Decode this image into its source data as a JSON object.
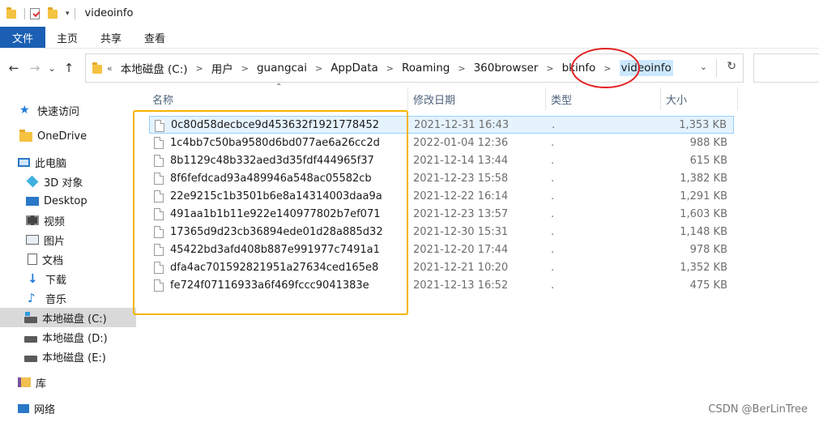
{
  "window": {
    "title": "videoinfo"
  },
  "quick_access_toolbar": {
    "icons": [
      "folder-icon",
      "properties-icon",
      "new-folder-icon",
      "dropdown-icon"
    ]
  },
  "ribbon": {
    "tabs": [
      "文件",
      "主页",
      "共享",
      "查看"
    ]
  },
  "address": {
    "crumbs": [
      "本地磁盘 (C:)",
      "用户",
      "guangcai",
      "AppData",
      "Roaming",
      "360browser",
      "bkinfo",
      "videoinfo"
    ],
    "overflow": "«"
  },
  "nav": {
    "back": "←",
    "forward": "→",
    "recent": "⌄",
    "up": "↑",
    "refresh": "↻"
  },
  "sidebar": {
    "items": [
      {
        "label": "快速访问",
        "icon": "star-icon"
      },
      {
        "label": "OneDrive",
        "icon": "folder-icon"
      },
      {
        "label": "此电脑",
        "icon": "pc-icon"
      },
      {
        "label": "3D 对象",
        "icon": "cube-icon"
      },
      {
        "label": "Desktop",
        "icon": "desktop-icon"
      },
      {
        "label": "视频",
        "icon": "video-icon"
      },
      {
        "label": "图片",
        "icon": "picture-icon"
      },
      {
        "label": "文档",
        "icon": "document-icon"
      },
      {
        "label": "下载",
        "icon": "download-icon"
      },
      {
        "label": "音乐",
        "icon": "music-icon"
      },
      {
        "label": "本地磁盘 (C:)",
        "icon": "drive-c-icon"
      },
      {
        "label": "本地磁盘 (D:)",
        "icon": "drive-icon"
      },
      {
        "label": "本地磁盘 (E:)",
        "icon": "drive-icon"
      },
      {
        "label": "库",
        "icon": "library-icon"
      },
      {
        "label": "网络",
        "icon": "network-icon"
      }
    ]
  },
  "columns": {
    "name": "名称",
    "modified": "修改日期",
    "type": "类型",
    "size": "大小"
  },
  "files": [
    {
      "name": "0c80d58decbce9d453632f1921778452",
      "modified": "2021-12-31 16:43",
      "type": ".",
      "size": "1,353 KB"
    },
    {
      "name": "1c4bb7c50ba9580d6bd077ae6a26cc2d",
      "modified": "2022-01-04 12:36",
      "type": ".",
      "size": "988 KB"
    },
    {
      "name": "8b1129c48b332aed3d35fdf444965f37",
      "modified": "2021-12-14 13:44",
      "type": ".",
      "size": "615 KB"
    },
    {
      "name": "8f6fefdcad93a489946a548ac05582cb",
      "modified": "2021-12-23 15:58",
      "type": ".",
      "size": "1,382 KB"
    },
    {
      "name": "22e9215c1b3501b6e8a14314003daa9a",
      "modified": "2021-12-22 16:14",
      "type": ".",
      "size": "1,291 KB"
    },
    {
      "name": "491aa1b1b11e922e140977802b7ef071",
      "modified": "2021-12-23 13:57",
      "type": ".",
      "size": "1,603 KB"
    },
    {
      "name": "17365d9d23cb36894ede01d28a885d32",
      "modified": "2021-12-30 15:31",
      "type": ".",
      "size": "1,148 KB"
    },
    {
      "name": "45422bd3afd408b887e991977c7491a1",
      "modified": "2021-12-20 17:44",
      "type": ".",
      "size": "978 KB"
    },
    {
      "name": "dfa4ac701592821951a27634ced165e8",
      "modified": "2021-12-21 10:20",
      "type": ".",
      "size": "1,352 KB"
    },
    {
      "name": "fe724f07116933a6f469fccc9041383e",
      "modified": "2021-12-13 16:52",
      "type": ".",
      "size": "475 KB"
    }
  ],
  "watermark": "CSDN @BerLinTree",
  "annotations": {
    "highlight_color": "#f5b400",
    "circle_color": "#e22222"
  }
}
